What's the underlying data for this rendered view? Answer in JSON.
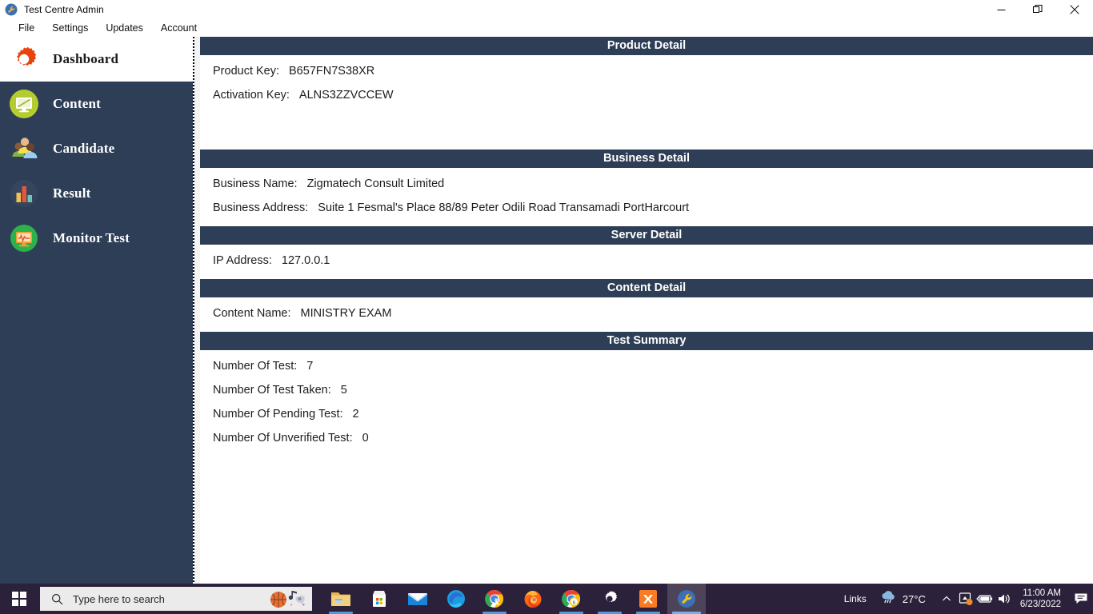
{
  "window": {
    "title": "Test Centre Admin",
    "app_icon": "wrench-gear-icon",
    "controls": {
      "minimize": "minimize-icon",
      "restore": "restore-icon",
      "close": "close-icon"
    }
  },
  "menubar": {
    "items": [
      {
        "label": "File"
      },
      {
        "label": "Settings"
      },
      {
        "label": "Updates"
      },
      {
        "label": "Account"
      }
    ]
  },
  "sidebar": {
    "items": [
      {
        "label": "Dashboard",
        "icon": "gear-icon",
        "active": true
      },
      {
        "label": "Content",
        "icon": "monitor-icon",
        "active": false
      },
      {
        "label": "Candidate",
        "icon": "users-icon",
        "active": false
      },
      {
        "label": "Result",
        "icon": "bar-chart-icon",
        "active": false
      },
      {
        "label": "Monitor Test",
        "icon": "pulse-monitor-icon",
        "active": false
      }
    ]
  },
  "content": {
    "sections": [
      {
        "header": "Product Detail",
        "body_height": 118,
        "fields": [
          {
            "label": "Product Key:",
            "value": "B657FN7S38XR"
          },
          {
            "label": "Activation Key:",
            "value": "ALNS3ZZVCCEW"
          }
        ]
      },
      {
        "header": "Business Detail",
        "body_height": 74,
        "fields": [
          {
            "label": "Business Name:",
            "value": "Zigmatech Consult Limited"
          },
          {
            "label": "Business Address:",
            "value": "Suite 1 Fesmal's Place 88/89 Peter Odili Road Transamadi PortHarcourt"
          }
        ]
      },
      {
        "header": "Server Detail",
        "body_height": 43,
        "fields": [
          {
            "label": "IP Address:",
            "value": "127.0.0.1"
          }
        ]
      },
      {
        "header": "Content Detail",
        "body_height": 43,
        "fields": [
          {
            "label": "Content Name:",
            "value": "MINISTRY EXAM"
          }
        ]
      },
      {
        "header": "Test Summary",
        "body_height": 260,
        "fields": [
          {
            "label": "Number Of Test:",
            "value": "7"
          },
          {
            "label": "Number Of Test Taken:",
            "value": "5"
          },
          {
            "label": "Number Of Pending Test:",
            "value": "2"
          },
          {
            "label": "Number Of Unverified Test:",
            "value": "0"
          }
        ]
      }
    ]
  },
  "taskbar": {
    "start": "windows-start-icon",
    "search": {
      "placeholder": "Type here to search",
      "icon": "search-icon",
      "doodle": "basketball-doodle-icon"
    },
    "apps": [
      {
        "name": "file-explorer-icon",
        "state": "running"
      },
      {
        "name": "microsoft-store-icon",
        "state": "idle"
      },
      {
        "name": "mail-icon",
        "state": "idle"
      },
      {
        "name": "microsoft-edge-icon",
        "state": "idle"
      },
      {
        "name": "chrome-icon",
        "state": "running"
      },
      {
        "name": "firefox-icon",
        "state": "idle"
      },
      {
        "name": "chrome-remote-icon",
        "state": "running"
      },
      {
        "name": "settings-gear-icon",
        "state": "running"
      },
      {
        "name": "xampp-icon",
        "state": "running"
      },
      {
        "name": "test-centre-admin-icon",
        "state": "active"
      }
    ],
    "tray": {
      "links_label": "Links",
      "weather_icon": "cloud-rain-icon",
      "temperature": "27°C",
      "chevron": "chevron-up-icon",
      "icons": [
        {
          "name": "onedrive-sync-icon"
        },
        {
          "name": "battery-charging-icon"
        },
        {
          "name": "volume-icon"
        }
      ],
      "time": "11:00 AM",
      "date": "6/23/2022",
      "action_center": "action-center-icon"
    }
  },
  "colors": {
    "navy": "#2d3e56",
    "taskbar": "#2b213a",
    "accent_orange": "#e8430d",
    "content_bg": "#ffffff"
  }
}
